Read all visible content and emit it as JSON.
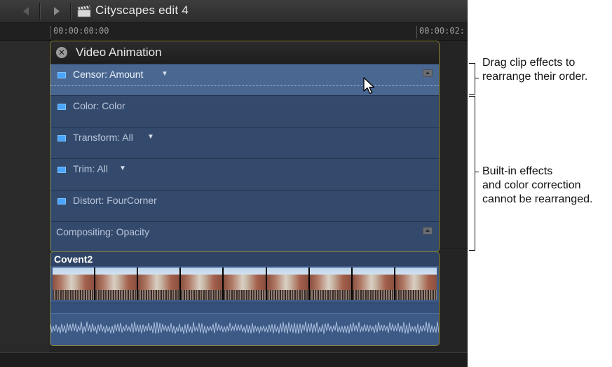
{
  "window": {
    "project_title": "Cityscapes edit 4"
  },
  "ruler": {
    "start_timecode": "00:00:00:00",
    "next_timecode": "00:00:02:"
  },
  "animation_panel": {
    "title": "Video Animation",
    "effects": [
      {
        "label": "Censor: Amount",
        "has_dropdown": true,
        "selected": true,
        "has_toggle": true
      },
      {
        "label": "Color: Color",
        "has_dropdown": false,
        "selected": false,
        "has_toggle": true
      },
      {
        "label": "Transform: All",
        "has_dropdown": true,
        "selected": false,
        "has_toggle": true
      },
      {
        "label": "Trim: All",
        "has_dropdown": true,
        "selected": false,
        "has_toggle": true
      },
      {
        "label": "Distort: FourCorner",
        "has_dropdown": false,
        "selected": false,
        "has_toggle": true
      },
      {
        "label": "Compositing: Opacity",
        "has_dropdown": false,
        "selected": false,
        "has_toggle": false
      }
    ]
  },
  "clip": {
    "name": "Covent2"
  },
  "annotations": {
    "callout_1_line_1": "Drag clip effects to",
    "callout_1_line_2": "rearrange their order.",
    "callout_2_line_1": "Built-in effects",
    "callout_2_line_2": "and color correction",
    "callout_2_line_3": "cannot be rearranged."
  },
  "colors": {
    "panel_background": "#344a6d",
    "selected_row": "#4a6792",
    "effect_toggle_blue": "#4aa5ff",
    "clip_border": "#8c8538"
  },
  "icons": [
    "back-arrow-icon",
    "forward-arrow-icon",
    "clapperboard-icon",
    "close-icon",
    "chevron-down-icon",
    "expand-icon",
    "mouse-pointer-icon"
  ]
}
